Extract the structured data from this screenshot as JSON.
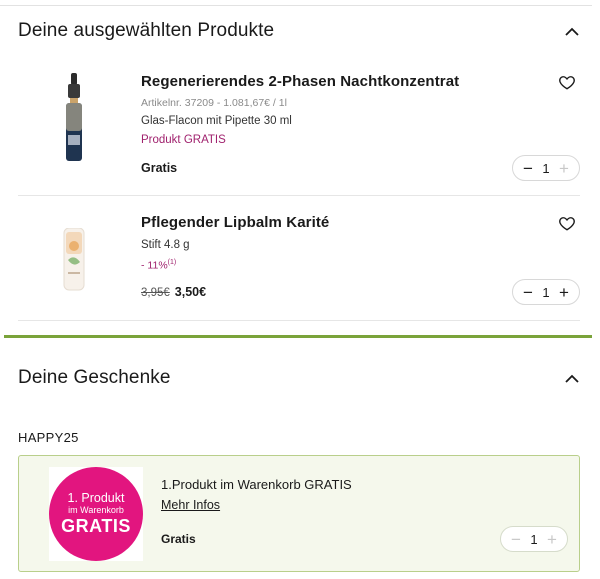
{
  "selected_section": {
    "title": "Deine ausgewählten Produkte"
  },
  "products": [
    {
      "name": "Regenerierendes 2-Phasen Nachtkonzentrat",
      "meta": "Artikelnr. 37209 - 1.081,67€ / 1l",
      "description": "Glas-Flacon mit Pipette 30 ml",
      "promo": "Produkt GRATIS",
      "price": "Gratis",
      "quantity": "1",
      "minus": "−",
      "plus": "+"
    },
    {
      "name": "Pflegender Lipbalm Karité",
      "description": "Stift 4.8 g",
      "discount": "- 11%",
      "discount_note": "(1)",
      "old_price": "3,95€",
      "price": "3,50€",
      "quantity": "1",
      "minus": "−",
      "plus": "+"
    }
  ],
  "gifts_section": {
    "title": "Deine Geschenke",
    "code": "HAPPY25",
    "gift": {
      "badge_line1": "1. Produkt",
      "badge_line2": "im Warenkorb",
      "badge_line3": "GRATIS",
      "title": "1.Produkt im Warenkorb GRATIS",
      "link": "Mehr Infos",
      "price": "Gratis",
      "quantity": "1",
      "minus": "−",
      "plus": "+"
    }
  },
  "colors": {
    "accent_green": "#7aa33a",
    "promo_magenta": "#a0226e",
    "badge_pink": "#e2157f",
    "gift_bg": "#f5f8ec"
  },
  "icons": {
    "collapse": "chevron-up-icon",
    "wishlist": "heart-icon"
  }
}
